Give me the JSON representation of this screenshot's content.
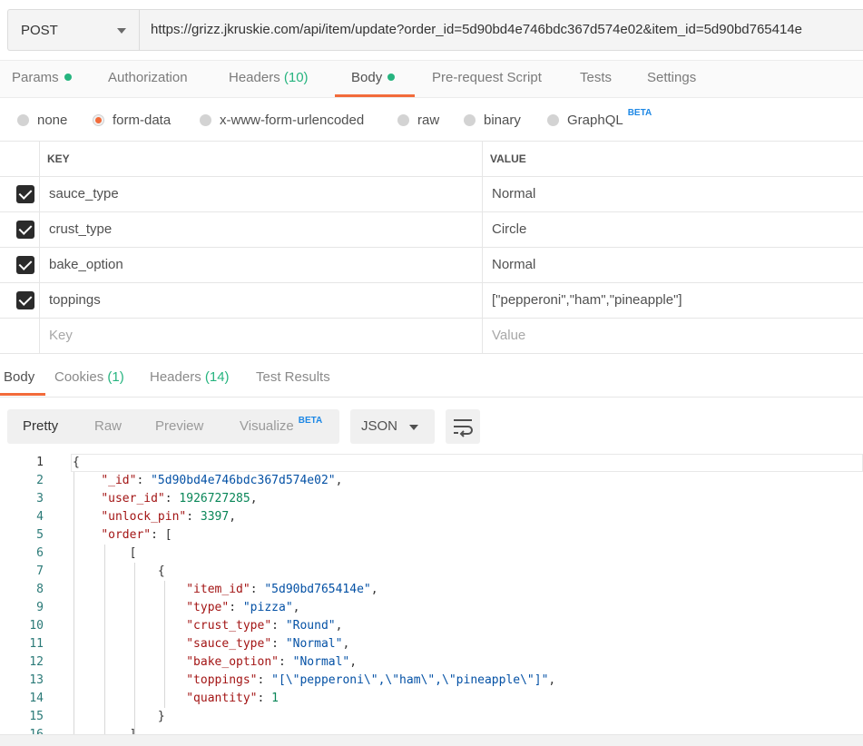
{
  "request": {
    "method": "POST",
    "url": "https://grizz.jkruskie.com/api/item/update?order_id=5d90bd4e746bdc367d574e02&item_id=5d90bd765414e"
  },
  "request_tabs": [
    {
      "label": "Params",
      "dot": true
    },
    {
      "label": "Authorization"
    },
    {
      "label": "Headers",
      "count": "(10)"
    },
    {
      "label": "Body",
      "dot": true,
      "active": true
    },
    {
      "label": "Pre-request Script"
    },
    {
      "label": "Tests"
    },
    {
      "label": "Settings"
    }
  ],
  "body_types": [
    {
      "label": "none"
    },
    {
      "label": "form-data",
      "selected": true
    },
    {
      "label": "x-www-form-urlencoded"
    },
    {
      "label": "raw"
    },
    {
      "label": "binary"
    },
    {
      "label": "GraphQL",
      "badge": "BETA"
    }
  ],
  "form_table": {
    "headers": {
      "key": "KEY",
      "value": "VALUE"
    },
    "rows": [
      {
        "key": "sauce_type",
        "value": "Normal",
        "checked": true
      },
      {
        "key": "crust_type",
        "value": "Circle",
        "checked": true
      },
      {
        "key": "bake_option",
        "value": "Normal",
        "checked": true
      },
      {
        "key": "toppings",
        "value": "[\"pepperoni\",\"ham\",\"pineapple\"]",
        "checked": true
      }
    ],
    "placeholder": {
      "key": "Key",
      "value": "Value"
    }
  },
  "response_tabs": [
    {
      "label": "Body",
      "active": true
    },
    {
      "label": "Cookies",
      "count": "(1)"
    },
    {
      "label": "Headers",
      "count": "(14)"
    },
    {
      "label": "Test Results"
    }
  ],
  "view_modes": [
    {
      "label": "Pretty",
      "active": true
    },
    {
      "label": "Raw"
    },
    {
      "label": "Preview"
    },
    {
      "label": "Visualize",
      "badge": "BETA"
    }
  ],
  "format": "JSON",
  "code_lines": [
    {
      "n": "1",
      "text": "{"
    },
    {
      "n": "2",
      "text": "    \"_id\": \"5d90bd4e746bdc367d574e02\","
    },
    {
      "n": "3",
      "text": "    \"user_id\": 1926727285,"
    },
    {
      "n": "4",
      "text": "    \"unlock_pin\": 3397,"
    },
    {
      "n": "5",
      "text": "    \"order\": ["
    },
    {
      "n": "6",
      "text": "        ["
    },
    {
      "n": "7",
      "text": "            {"
    },
    {
      "n": "8",
      "text": "                \"item_id\": \"5d90bd765414e\","
    },
    {
      "n": "9",
      "text": "                \"type\": \"pizza\","
    },
    {
      "n": "10",
      "text": "                \"crust_type\": \"Round\","
    },
    {
      "n": "11",
      "text": "                \"sauce_type\": \"Normal\","
    },
    {
      "n": "12",
      "text": "                \"bake_option\": \"Normal\","
    },
    {
      "n": "13",
      "text": "                \"toppings\": \"[\\\"pepperoni\\\",\\\"ham\\\",\\\"pineapple\\\"]\","
    },
    {
      "n": "14",
      "text": "                \"quantity\": 1"
    },
    {
      "n": "15",
      "text": "            }"
    },
    {
      "n": "16",
      "text": "        ]"
    }
  ],
  "colors": {
    "accent": "#f26b3a",
    "green": "#26b47f",
    "beta_blue": "#1e88e5",
    "json_key": "#a31515",
    "json_string": "#0451a5",
    "json_number": "#098658"
  },
  "icons": {
    "method_dropdown": "chevron-down-icon",
    "checkbox": "checkbox-checked-icon",
    "wrap": "wrap-lines-icon"
  }
}
